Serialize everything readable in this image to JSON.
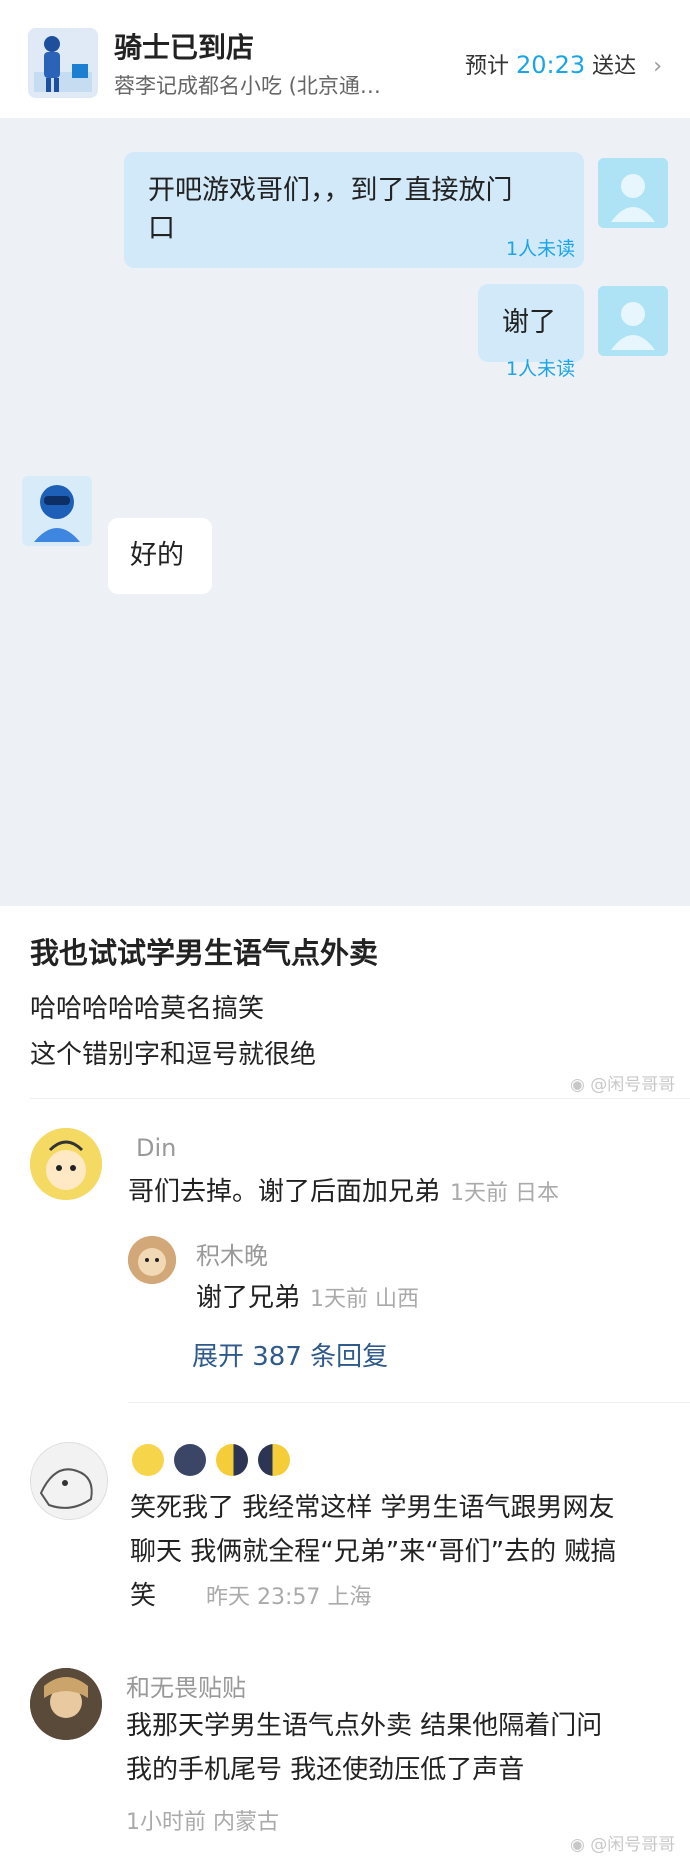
{
  "header": {
    "title": "骑士已到店",
    "subtitle": "蓉李记成都名小吃 (北京通…",
    "eta_prefix": "预计",
    "eta_time": "20:23",
    "eta_suffix": "送达",
    "chevron": "›"
  },
  "chat": {
    "messages": [
      {
        "from": "me",
        "text_line1": "开吧游戏哥们，，到了直接放门",
        "text_line2": "口",
        "status": "1人未读"
      },
      {
        "from": "me",
        "text_line1": "谢了",
        "status": "1人未读"
      },
      {
        "from": "rider",
        "text_line1": "好的"
      }
    ]
  },
  "post": {
    "title": "我也试试学男生语气点外卖",
    "line1": "哈哈哈哈哈莫名搞笑",
    "line2": "这个错别字和逗号就很绝",
    "watermark": "@闲号哥哥"
  },
  "comments": [
    {
      "name": "Din",
      "text": "哥们去掉。谢了后面加兄弟",
      "meta": "1天前 日本",
      "reply": {
        "name": "积木晚",
        "text": "谢了兄弟",
        "meta": "1天前 山西"
      },
      "expand": "展开 387 条回复"
    },
    {
      "name": "",
      "text_line1": "笑死我了 我经常这样 学男生语气跟男网友",
      "text_line2": "聊天 我俩就全程“兄弟”来“哥们”去的 贼搞",
      "text_line3": "笑",
      "meta": "昨天 23:57 上海"
    },
    {
      "name": "和无畏贴贴",
      "text_line1": "我那天学男生语气点外卖 结果他隔着门问",
      "text_line2": "我的手机尾号 我还使劲压低了声音",
      "meta": "1小时前 内蒙古"
    }
  ],
  "footer_watermark": "@闲号哥哥",
  "colors": {
    "accent": "#1aa6e6",
    "chat_bg": "#edf1f5",
    "bubble_out": "#d2e9fa",
    "link": "#2f5a8a"
  },
  "icons": [
    "rider-avatar-icon",
    "user-avatar-icon",
    "chevron-right-icon",
    "weibo-logo-icon",
    "moon-emoji-icon"
  ]
}
